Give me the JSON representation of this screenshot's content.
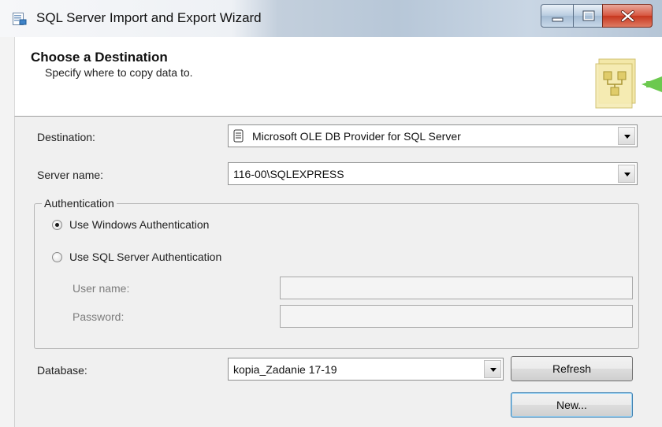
{
  "window": {
    "title": "SQL Server Import and Export Wizard",
    "controls": [
      "minimize-icon",
      "maximize-icon",
      "close-icon"
    ]
  },
  "header": {
    "title": "Choose a Destination",
    "subtitle": "Specify where to copy data to.",
    "graphic_icon": "wizard-destination-icon"
  },
  "destination": {
    "label": "Destination:",
    "value": "Microsoft OLE DB Provider for SQL Server",
    "icon": "database-icon"
  },
  "server": {
    "label": "Server name:",
    "value": "116-00\\SQLEXPRESS"
  },
  "authentication": {
    "legend": "Authentication",
    "windows_label": "Use Windows Authentication",
    "sql_label": "Use SQL Server Authentication",
    "selected": "windows",
    "username_label": "User name:",
    "password_label": "Password:",
    "username_value": "",
    "password_value": ""
  },
  "database": {
    "label": "Database:",
    "value": "kopia_Zadanie 17-19",
    "refresh_label": "Refresh",
    "new_label": "New..."
  },
  "colors": {
    "accent_green": "#6cc94f",
    "graphic_yellow": "#f1e49a",
    "close_red": "#c7361e"
  }
}
